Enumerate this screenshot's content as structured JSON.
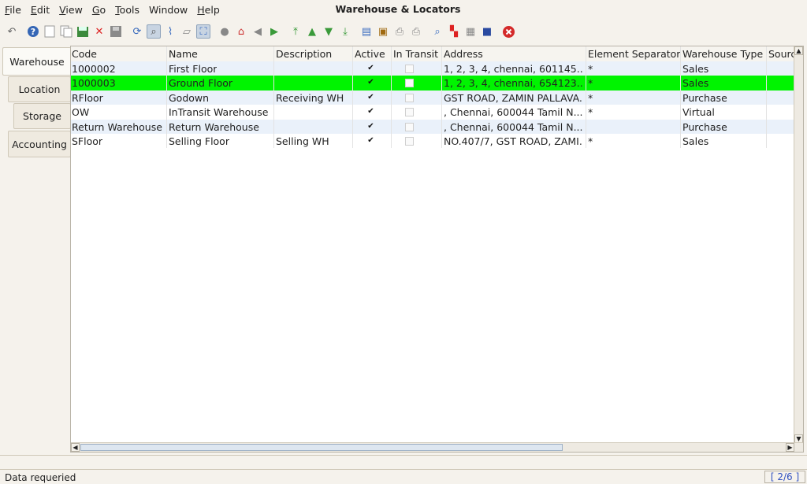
{
  "menu": [
    {
      "label": "File",
      "mnemonic": "F",
      "rest": "ile"
    },
    {
      "label": "Edit",
      "mnemonic": "E",
      "rest": "dit"
    },
    {
      "label": "View",
      "mnemonic": "V",
      "rest": "iew"
    },
    {
      "label": "Go",
      "mnemonic": "G",
      "rest": "o"
    },
    {
      "label": "Tools",
      "mnemonic": "T",
      "rest": "ools"
    },
    {
      "label": "Window",
      "mnemonic": "",
      "rest": "Window"
    },
    {
      "label": "Help",
      "mnemonic": "H",
      "rest": "elp"
    }
  ],
  "window_title": "Warehouse & Locators",
  "tabs": [
    "Warehouse",
    "Location",
    "Storage",
    "Accounting"
  ],
  "columns": [
    "Code",
    "Name",
    "Description",
    "Active",
    "In Transit",
    "Address",
    "Element Separator",
    "Warehouse Type",
    "Source"
  ],
  "rows": [
    {
      "code": "1000002",
      "name": "First Floor",
      "description": "",
      "active": true,
      "in_transit": false,
      "address": "1, 2, 3, 4, chennai,  601145...",
      "separator": "*",
      "type": "Sales"
    },
    {
      "code": "1000003",
      "name": "Ground Floor",
      "description": "",
      "active": true,
      "in_transit": false,
      "address": "1, 2, 3, 4, chennai,  654123...",
      "separator": "*",
      "type": "Sales"
    },
    {
      "code": "RFloor",
      "name": "Godown",
      "description": "Receiving WH",
      "active": true,
      "in_transit": false,
      "address": "GST ROAD, ZAMIN PALLAVA...",
      "separator": "*",
      "type": "Purchase"
    },
    {
      "code": "OW",
      "name": "InTransit Warehouse",
      "description": "",
      "active": true,
      "in_transit": false,
      "address": ", Chennai,  600044 Tamil N...",
      "separator": "*",
      "type": "Virtual"
    },
    {
      "code": "Return Warehouse",
      "name": "Return Warehouse",
      "description": "",
      "active": true,
      "in_transit": false,
      "address": ", Chennai,  600044 Tamil N...",
      "separator": "",
      "type": "Purchase"
    },
    {
      "code": "SFloor",
      "name": "Selling Floor",
      "description": "Selling WH",
      "active": true,
      "in_transit": false,
      "address": "NO.407/7, GST ROAD, ZAMI...",
      "separator": "*",
      "type": "Sales"
    }
  ],
  "selected_row": 1,
  "status": {
    "message": "Data requeried",
    "record": "[ 2/6 ]"
  },
  "colors": {
    "selected_row": "#00f400",
    "alt_row": "#eaf1fa",
    "record_text": "#3050c0"
  }
}
